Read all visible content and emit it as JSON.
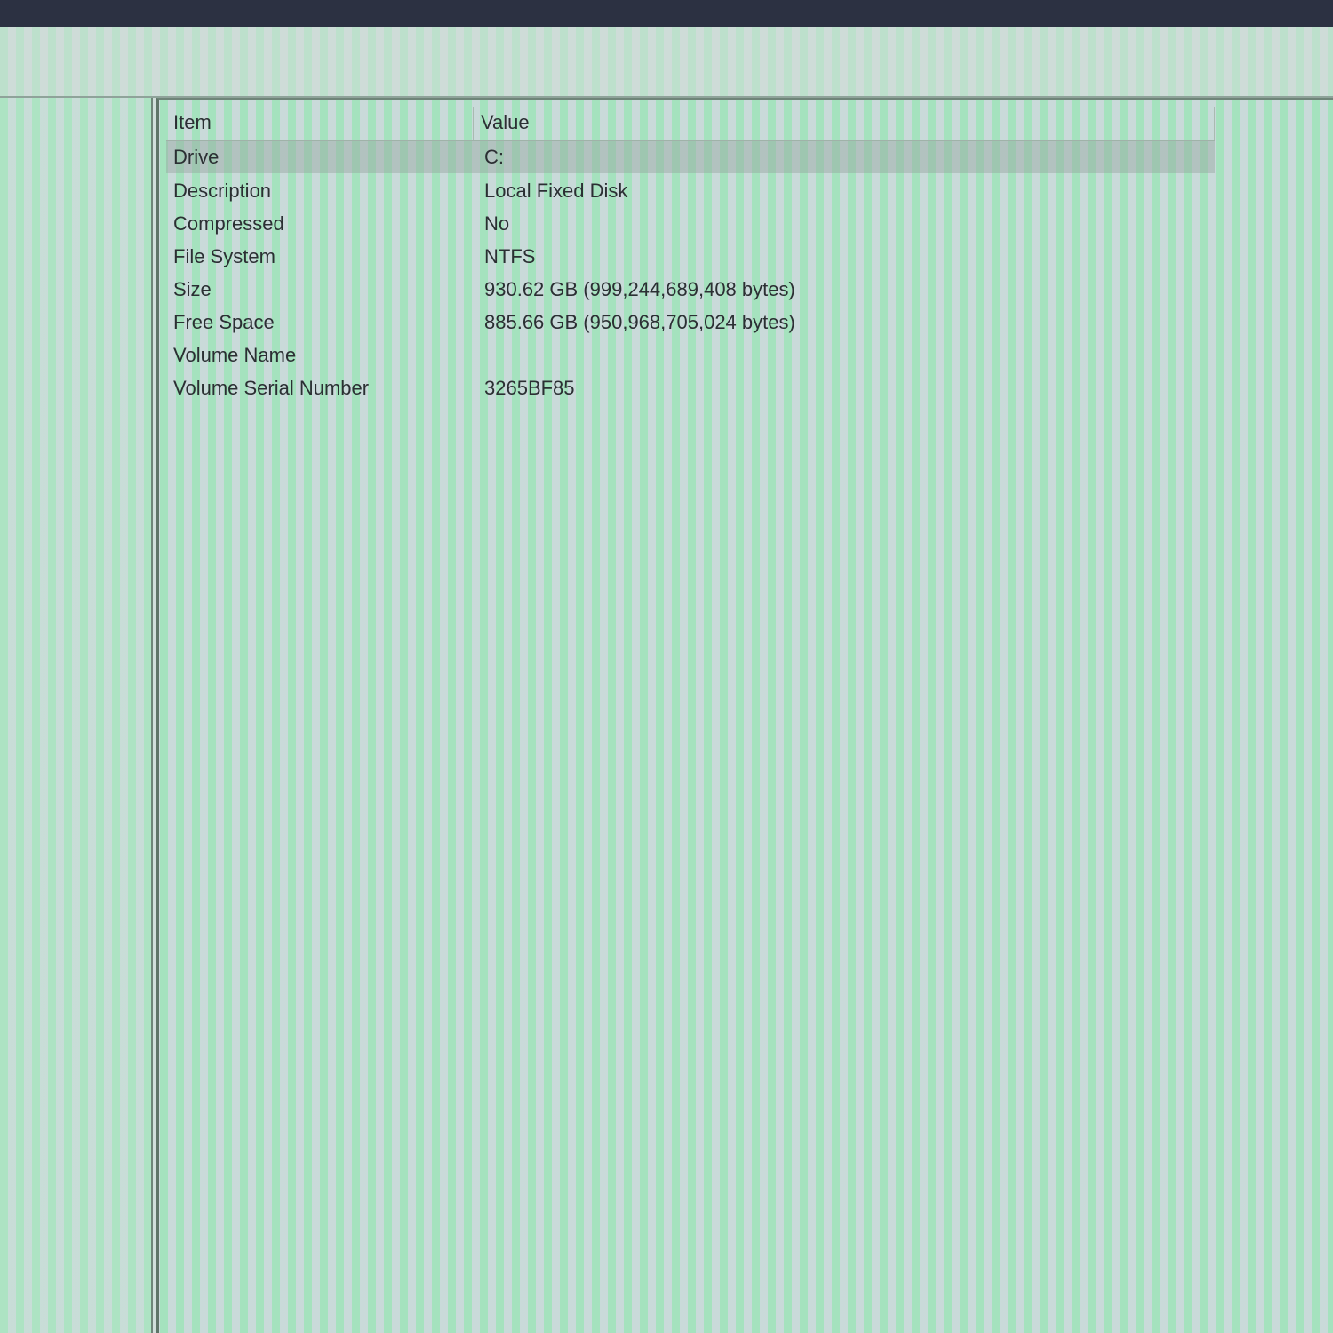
{
  "table": {
    "columns": {
      "item": "Item",
      "value": "Value"
    },
    "rows": [
      {
        "item": "Drive",
        "value": "C:"
      },
      {
        "item": "Description",
        "value": "Local Fixed Disk"
      },
      {
        "item": "Compressed",
        "value": "No"
      },
      {
        "item": "File System",
        "value": "NTFS"
      },
      {
        "item": "Size",
        "value": "930.62 GB (999,244,689,408 bytes)"
      },
      {
        "item": "Free Space",
        "value": "885.66 GB (950,968,705,024 bytes)"
      },
      {
        "item": "Volume Name",
        "value": ""
      },
      {
        "item": "Volume Serial Number",
        "value": "3265BF85"
      }
    ],
    "selected_row": "Drive"
  }
}
